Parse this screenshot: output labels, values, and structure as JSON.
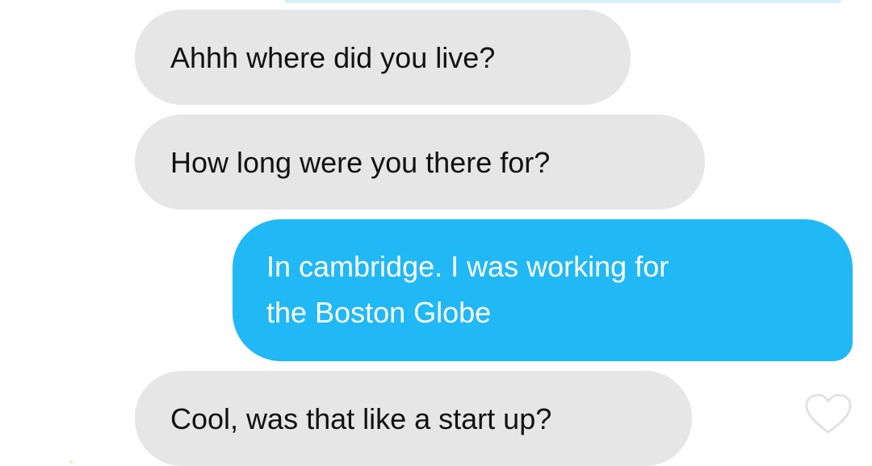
{
  "conversation": {
    "messages": [
      {
        "direction": "received",
        "lines": [
          "Ahhh where did you live?"
        ]
      },
      {
        "direction": "received",
        "lines": [
          "How long were you there for?"
        ]
      },
      {
        "direction": "sent",
        "lines": [
          "In cambridge. I was working for",
          "the Boston Globe"
        ]
      },
      {
        "direction": "received",
        "lines": [
          "Cool, was that like a start up?"
        ]
      }
    ],
    "like_icon": "heart-outline-icon"
  },
  "colors": {
    "received_bubble": "#e6e6e6",
    "sent_bubble": "#21b8f6",
    "received_text": "#111111",
    "sent_text": "#ffffff",
    "like_icon": "#e2e2e2"
  }
}
